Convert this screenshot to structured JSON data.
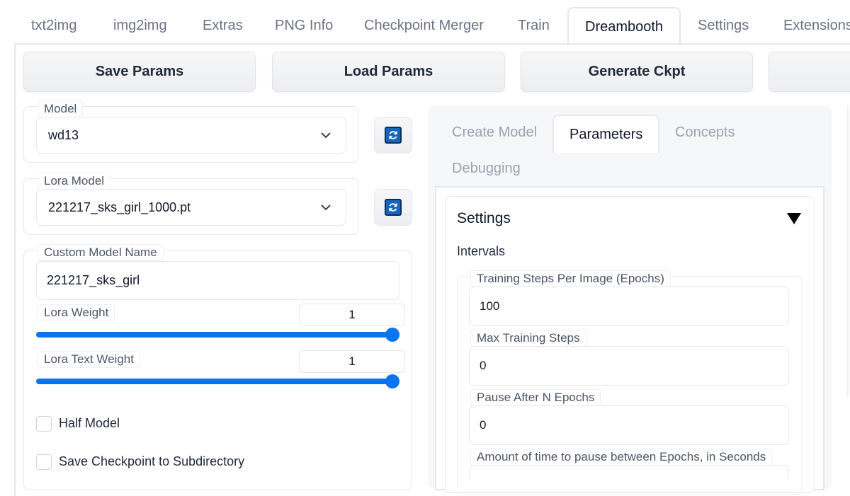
{
  "tabs": [
    {
      "label": "txt2img"
    },
    {
      "label": "img2img"
    },
    {
      "label": "Extras"
    },
    {
      "label": "PNG Info"
    },
    {
      "label": "Checkpoint Merger"
    },
    {
      "label": "Train"
    },
    {
      "label": "Dreambooth",
      "active": true
    },
    {
      "label": "Settings"
    },
    {
      "label": "Extensions"
    }
  ],
  "toolbar": {
    "save_params": "Save Params",
    "load_params": "Load Params",
    "generate_ckpt": "Generate Ckpt"
  },
  "left": {
    "model_label": "Model",
    "model_value": "wd13",
    "lora_model_label": "Lora Model",
    "lora_model_value": "221217_sks_girl_1000.pt",
    "custom_model_name_label": "Custom Model Name",
    "custom_model_name_value": "221217_sks_girl",
    "lora_weight_label": "Lora Weight",
    "lora_weight_value": "1",
    "lora_text_weight_label": "Lora Text Weight",
    "lora_text_weight_value": "1",
    "half_model_label": "Half Model",
    "save_ckpt_subdir_label": "Save Checkpoint to Subdirectory"
  },
  "right": {
    "subtabs": [
      {
        "label": "Create Model"
      },
      {
        "label": "Parameters",
        "active": true
      },
      {
        "label": "Concepts"
      },
      {
        "label": "Debugging"
      }
    ],
    "settings_title": "Settings",
    "intervals_label": "Intervals",
    "fields": [
      {
        "label": "Training Steps Per Image (Epochs)",
        "value": "100"
      },
      {
        "label": "Max Training Steps",
        "value": "0"
      },
      {
        "label": "Pause After N Epochs",
        "value": "0"
      },
      {
        "label": "Amount of time to pause between Epochs, in Seconds",
        "value": ""
      }
    ]
  },
  "colors": {
    "accent": "#0b74f0",
    "refresh_icon": "#1565c0"
  }
}
